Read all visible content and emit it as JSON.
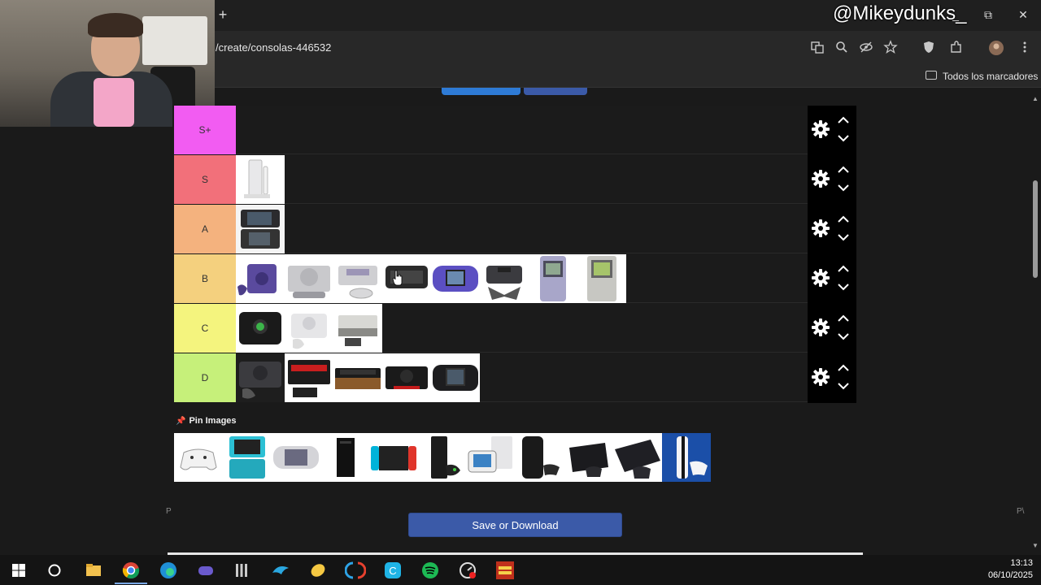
{
  "browser": {
    "url": "/create/consolas-446532",
    "bookmarks_label": "Todos los marcadores",
    "new_tab": "+",
    "win_min": "_",
    "win_restore": "⧉",
    "win_close": "✕"
  },
  "overlay": {
    "watermark": "@Mikeydunks_"
  },
  "tiers": [
    {
      "label": "S+",
      "color": "#f25cf2"
    },
    {
      "label": "S",
      "color": "#f2707a"
    },
    {
      "label": "A",
      "color": "#f4b27e"
    },
    {
      "label": "B",
      "color": "#f4d07e"
    },
    {
      "label": "C",
      "color": "#f4f47e"
    },
    {
      "label": "D",
      "color": "#c6f07a"
    }
  ],
  "pin": {
    "label": "Pin Images"
  },
  "side_marks": {
    "left": "P",
    "right": "P\\"
  },
  "actions": {
    "save": "Save or Download"
  },
  "clock": {
    "time": "13:13",
    "date": "06/10/2025"
  },
  "icons": {
    "tier_settings": "gear-icon",
    "move_up": "chevron-up-icon",
    "move_down": "chevron-down-icon",
    "pin": "pin-icon"
  }
}
